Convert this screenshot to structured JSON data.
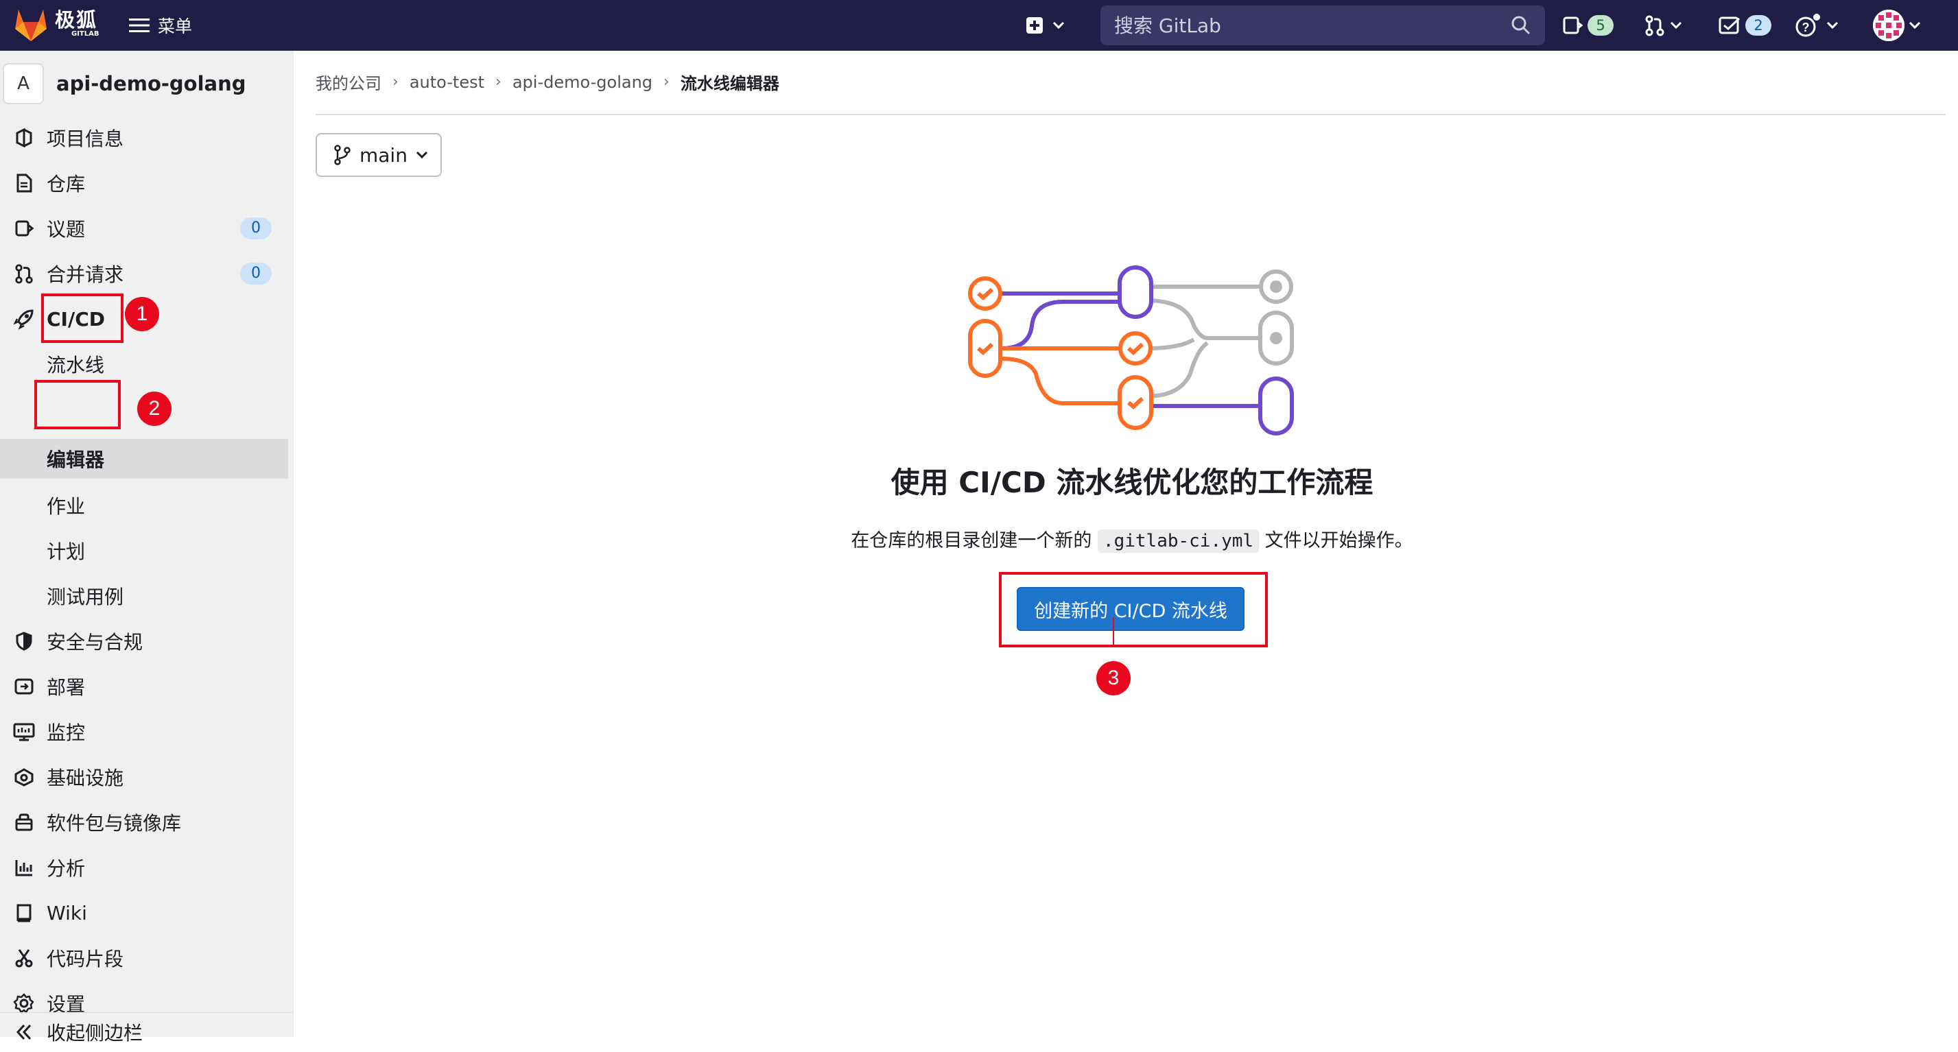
{
  "topbar": {
    "logo_text": "极狐",
    "logo_sub": "GITLAB",
    "menu_label": "菜单",
    "search_placeholder": "搜索 GitLab",
    "issues_count": "5",
    "todos_count": "2"
  },
  "project": {
    "avatar_letter": "A",
    "name": "api-demo-golang"
  },
  "sidebar": {
    "items": [
      {
        "label": "项目信息"
      },
      {
        "label": "仓库"
      },
      {
        "label": "议题",
        "count": "0"
      },
      {
        "label": "合并请求",
        "count": "0"
      },
      {
        "label": "CI/CD"
      },
      {
        "label": "流水线"
      },
      {
        "label": "编辑器"
      },
      {
        "label": "作业"
      },
      {
        "label": "计划"
      },
      {
        "label": "测试用例"
      },
      {
        "label": "安全与合规"
      },
      {
        "label": "部署"
      },
      {
        "label": "监控"
      },
      {
        "label": "基础设施"
      },
      {
        "label": "软件包与镜像库"
      },
      {
        "label": "分析"
      },
      {
        "label": "Wiki"
      },
      {
        "label": "代码片段"
      },
      {
        "label": "设置"
      }
    ],
    "collapse_label": "收起侧边栏"
  },
  "breadcrumb": [
    "我的公司",
    "auto-test",
    "api-demo-golang",
    "流水线编辑器"
  ],
  "branch": "main",
  "empty_state": {
    "title": "使用 CI/CD 流水线优化您的工作流程",
    "desc_before": "在仓库的根目录创建一个新的",
    "desc_code": ".gitlab-ci.yml",
    "desc_after": "文件以开始操作。",
    "button": "创建新的 CI/CD 流水线"
  },
  "annotations": [
    "1",
    "2",
    "3"
  ]
}
